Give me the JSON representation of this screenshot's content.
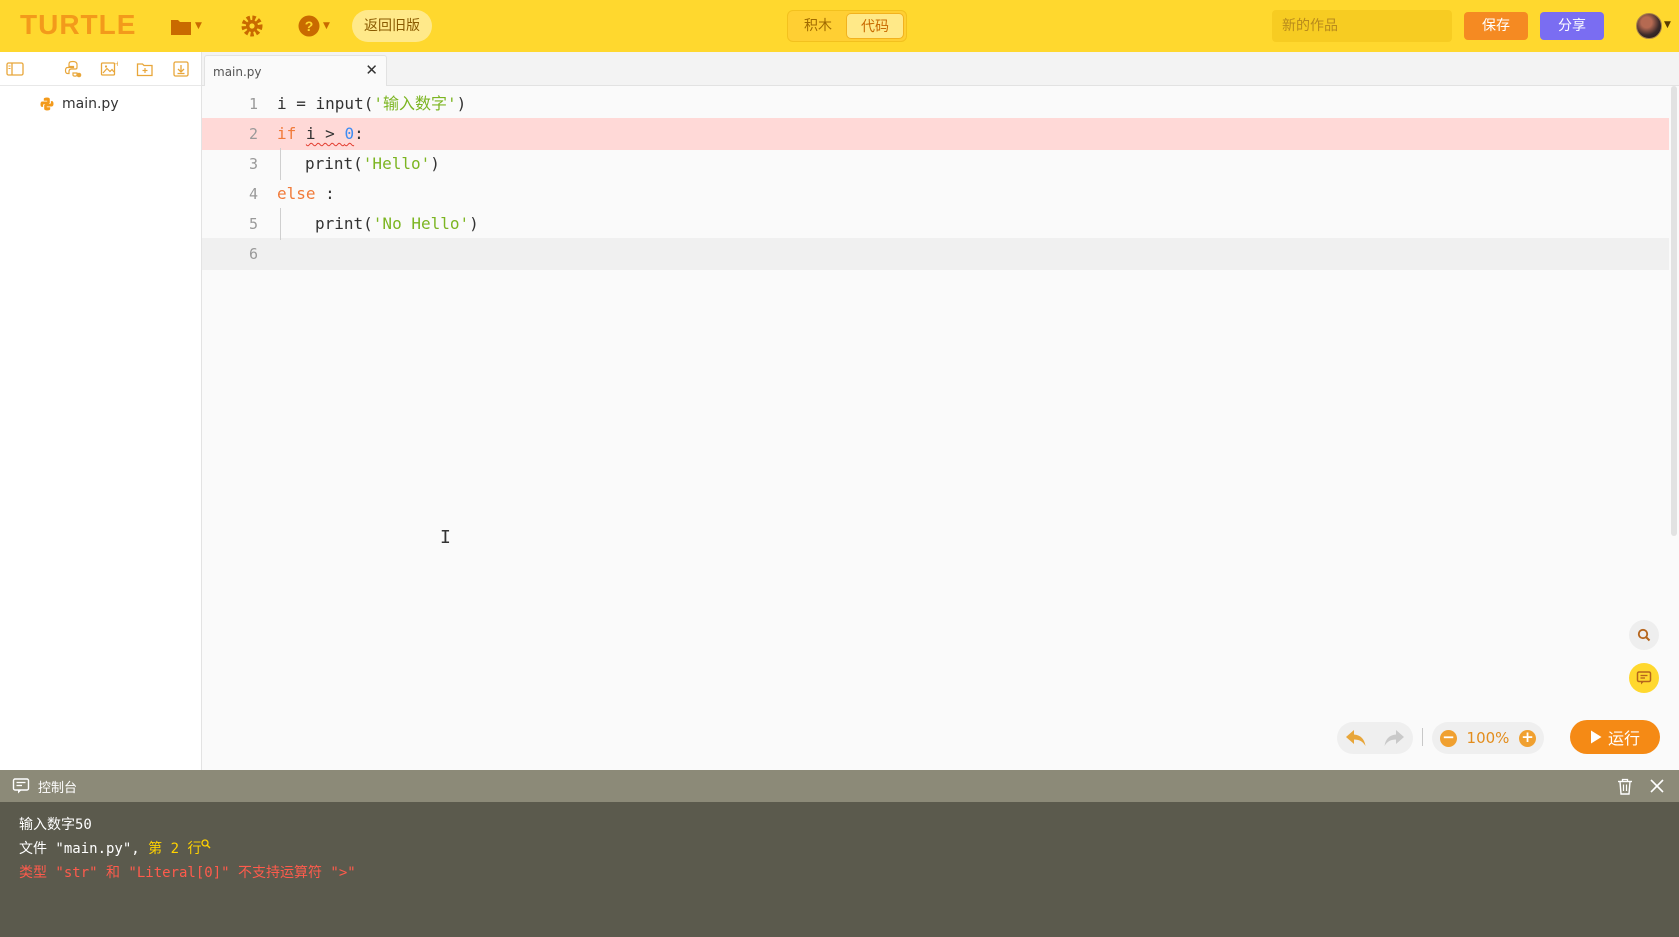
{
  "app": {
    "logo": "TURTLE",
    "old_version_label": "返回旧版",
    "mode_tabs": [
      "积木",
      "代码"
    ],
    "active_mode": "代码",
    "title_placeholder": "新的作品",
    "save_label": "保存",
    "share_label": "分享"
  },
  "sidebar": {
    "files": [
      {
        "name": "main.py",
        "type": "python"
      }
    ]
  },
  "editor": {
    "tab_label": "main.py",
    "lines": [
      {
        "num": "1",
        "text": "i = input('输入数字')"
      },
      {
        "num": "2",
        "text": "if i > 0:",
        "error": true
      },
      {
        "num": "3",
        "text": "print('Hello')"
      },
      {
        "num": "4",
        "text": "else :"
      },
      {
        "num": "5",
        "text": "print('No Hello')"
      },
      {
        "num": "6",
        "text": "",
        "current": true
      }
    ],
    "zoom": "100%",
    "run_label": "运行"
  },
  "console": {
    "title": "控制台",
    "output": "输入数字50",
    "file_line": {
      "prefix": "文件 \"main.py\", ",
      "lineinfo": "第 2 行"
    },
    "error": "类型 \"str\" 和 \"Literal[0]\" 不支持运算符 \">\""
  },
  "colors": {
    "topbar": "#ffd82e",
    "logo": "#f39a1b",
    "save": "#f58a22",
    "share": "#7a6df2",
    "run": "#f58a15",
    "error_line": "#ffd9d7",
    "console_bg": "#5b5a4d",
    "console_error": "#ff5b4c"
  },
  "icons": [
    "folder-icon",
    "gear-icon",
    "help-icon",
    "toggle-sidebar-icon",
    "python-file-icon",
    "image-file-icon",
    "new-folder-icon",
    "download-icon",
    "close-icon",
    "search-icon",
    "chat-icon",
    "undo-icon",
    "redo-icon",
    "zoom-out-icon",
    "zoom-in-icon",
    "play-icon",
    "console-icon",
    "trash-icon"
  ]
}
